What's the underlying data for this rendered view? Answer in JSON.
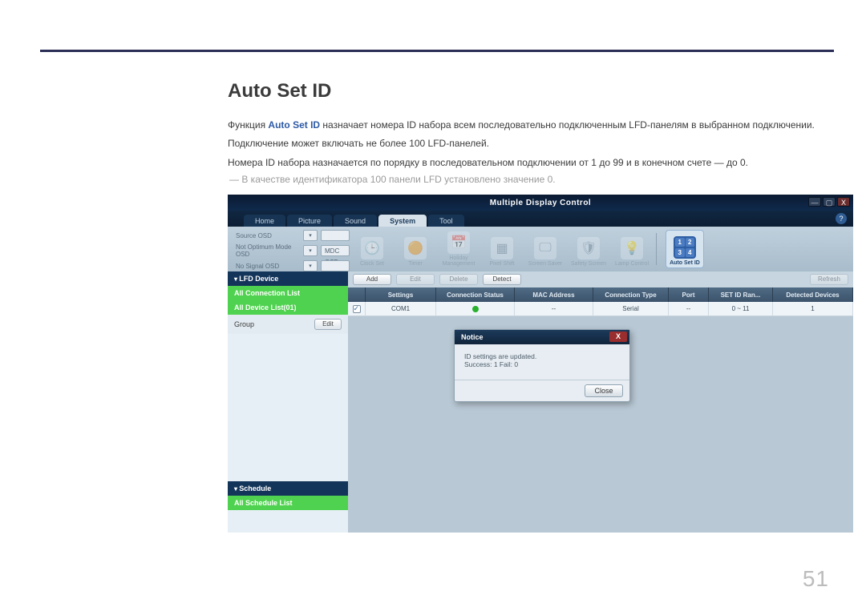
{
  "page_number": "51",
  "heading": "Auto Set ID",
  "para1_pre": "Функция ",
  "para1_kw": "Auto Set ID",
  "para1_post": " назначает номера ID набора всем последовательно подключенным LFD-панелям в выбранном подключении.",
  "para2": "Подключение может включать не более 100 LFD-панелей.",
  "para3": "Номера ID набора назначается по порядку в последовательном подключении от 1 до 99 и в конечном счете — до 0.",
  "note": "В качестве идентификатора 100 панели LFD установлено значение 0.",
  "app": {
    "title": "Multiple Display Control",
    "win_min": "—",
    "win_max": "▢",
    "win_close": "X",
    "help": "?",
    "tabs": [
      "Home",
      "Picture",
      "Sound",
      "System",
      "Tool"
    ],
    "active_tab_index": 3,
    "osd": [
      {
        "label": "Source OSD",
        "value": ""
      },
      {
        "label": "Not Optimum Mode OSD",
        "value": "MDC OSD"
      },
      {
        "label": "No Signal OSD",
        "value": ""
      }
    ],
    "tools": [
      {
        "label": "Clock Set",
        "icon": "🕒"
      },
      {
        "label": "Timer",
        "icon": "🟠"
      },
      {
        "label": "Holiday Management",
        "icon": "📅"
      },
      {
        "label": "Pixel Shift",
        "icon": "▦"
      },
      {
        "label": "Screen Saver",
        "icon": "🖵"
      },
      {
        "label": "Safety Screen",
        "icon": "🛡"
      },
      {
        "label": "Lamp Control",
        "icon": "💡"
      }
    ],
    "tool_auto": "Auto Set ID",
    "action_buttons": {
      "add": "Add",
      "edit": "Edit",
      "delete": "Delete",
      "detect": "Detect",
      "refresh": "Refresh"
    },
    "sidebar": {
      "lfd_hdr": "LFD Device",
      "all_conn": "All Connection List",
      "all_dev": "All Device List(01)",
      "group": "Group",
      "edit": "Edit",
      "sched_hdr": "Schedule",
      "all_sched": "All Schedule List"
    },
    "table": {
      "headers": [
        "",
        "Settings",
        "Connection Status",
        "MAC Address",
        "Connection Type",
        "Port",
        "SET ID Ran...",
        "Detected Devices"
      ],
      "row": {
        "settings": "COM1",
        "mac": "--",
        "type": "Serial",
        "port": "--",
        "range": "0 ~ 11",
        "detected": "1"
      }
    },
    "dialog": {
      "title": "Notice",
      "line1": "ID settings are updated.",
      "line2": "Success: 1  Fail: 0",
      "close": "Close"
    }
  }
}
